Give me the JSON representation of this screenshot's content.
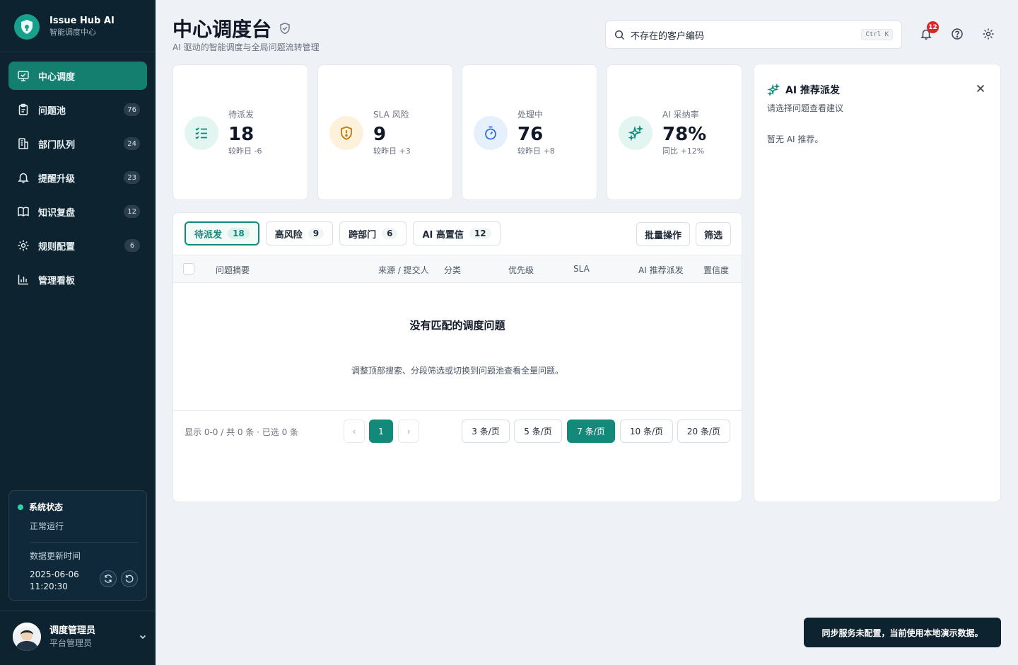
{
  "brand": {
    "name": "Issue Hub AI",
    "subtitle": "智能调度中心"
  },
  "sidebar": {
    "items": [
      {
        "label": "中心调度",
        "icon": "monitor-icon",
        "badge": ""
      },
      {
        "label": "问题池",
        "icon": "clipboard-icon",
        "badge": "76"
      },
      {
        "label": "部门队列",
        "icon": "building-icon",
        "badge": "24"
      },
      {
        "label": "提醒升级",
        "icon": "bell-icon",
        "badge": "23"
      },
      {
        "label": "知识复盘",
        "icon": "book-icon",
        "badge": "12"
      },
      {
        "label": "规则配置",
        "icon": "gear-icon",
        "badge": "6"
      },
      {
        "label": "管理看板",
        "icon": "bar-chart-icon",
        "badge": ""
      }
    ],
    "active_index": 0
  },
  "system_status": {
    "title": "系统状态",
    "value": "正常运行",
    "updated_label": "数据更新时间",
    "updated_time": "2025-06-06 11:20:30"
  },
  "user": {
    "name": "调度管理员",
    "role": "平台管理员"
  },
  "header": {
    "title": "中心调度台",
    "subtitle": "AI 驱动的智能调度与全局问题流转管理",
    "search_value": "不存在的客户编码",
    "search_shortcut": "Ctrl K",
    "notification_count": "12"
  },
  "stats": [
    {
      "label": "待派发",
      "value": "18",
      "delta": "较昨日 -6",
      "color": "#13897a"
    },
    {
      "label": "SLA 风险",
      "value": "9",
      "delta": "较昨日 +3",
      "color": "#c2780a"
    },
    {
      "label": "处理中",
      "value": "76",
      "delta": "较昨日 +8",
      "color": "#2b6fd6"
    },
    {
      "label": "AI 采纳率",
      "value": "78%",
      "delta": "同比 +12%",
      "color": "#13897a"
    }
  ],
  "tabs": [
    {
      "label": "待派发",
      "count": "18"
    },
    {
      "label": "高风险",
      "count": "9"
    },
    {
      "label": "跨部门",
      "count": "6"
    },
    {
      "label": "AI 高置信",
      "count": "12"
    }
  ],
  "actions": {
    "batch": "批量操作",
    "filter": "筛选"
  },
  "table": {
    "columns": [
      "问题摘要",
      "来源 / 提交人",
      "分类",
      "优先级",
      "SLA",
      "AI 推荐派发",
      "置信度"
    ],
    "empty_title": "没有匹配的调度问题",
    "empty_desc": "调整顶部搜索、分段筛选或切换到问题池查看全量问题。"
  },
  "pagination": {
    "info": "显示 0-0 / 共 0 条 · 已选 0 条",
    "prev": "‹",
    "next": "›",
    "current_page": "1",
    "page_sizes": [
      "3 条/页",
      "5 条/页",
      "7 条/页",
      "10 条/页",
      "20 条/页"
    ],
    "active_size_index": 2
  },
  "ai_panel": {
    "title": "AI 推荐派发",
    "subtitle": "请选择问题查看建议",
    "empty": "暂无 AI 推荐。"
  },
  "toast": "同步服务未配置，当前使用本地演示数据。",
  "colors": {
    "sidebar_bg": "#0e2330",
    "accent": "#13897a",
    "danger": "#dc2626"
  }
}
